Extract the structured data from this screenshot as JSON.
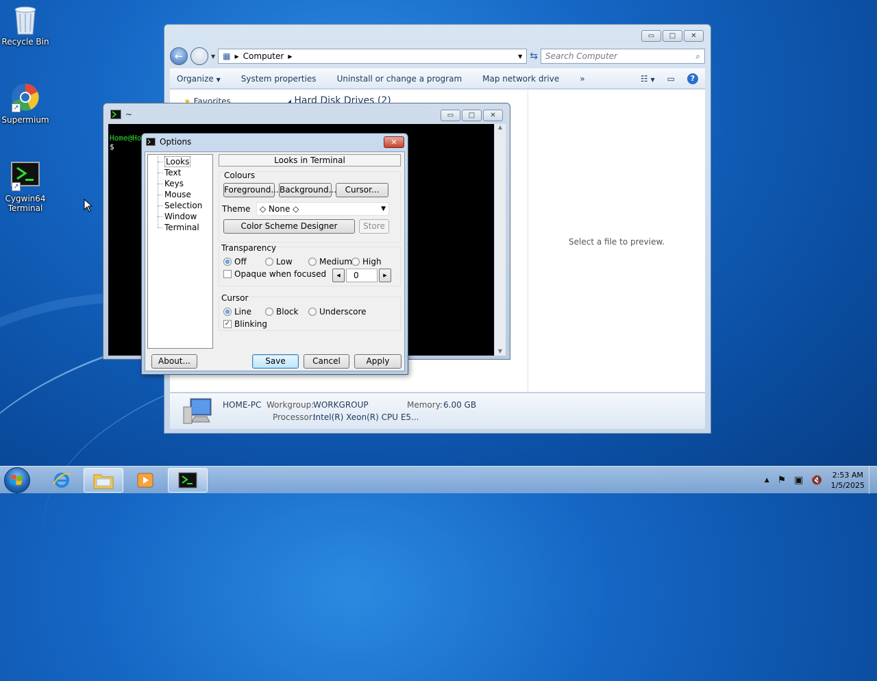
{
  "desktop": {
    "icons": [
      {
        "label": "Recycle Bin"
      },
      {
        "label": "Supermium"
      },
      {
        "label": "Cygwin64 Terminal"
      }
    ]
  },
  "explorer": {
    "address_parts": [
      "Computer"
    ],
    "search_placeholder": "Search Computer",
    "toolbar": {
      "organize": "Organize",
      "system_properties": "System properties",
      "uninstall": "Uninstall or change a program",
      "map_drive": "Map network drive",
      "more": "»"
    },
    "nav": {
      "favorites": "Favorites",
      "hard_disk_drives": "Hard Disk Drives (2)"
    },
    "preview_text": "Select a file to preview.",
    "details": {
      "pc_name": "HOME-PC",
      "workgroup_label": "Workgroup:",
      "workgroup_value": "WORKGROUP",
      "memory_label": "Memory:",
      "memory_value": "6.00 GB",
      "processor_label": "Processor:",
      "processor_value": "Intel(R) Xeon(R) CPU E5..."
    }
  },
  "terminal": {
    "title": "~",
    "prompt_line": "Home@Ho",
    "prompt_symbol": "$"
  },
  "options": {
    "title": "Options",
    "tree": [
      "Looks",
      "Text",
      "Keys",
      "Mouse",
      "Selection",
      "Window",
      "Terminal"
    ],
    "section_header": "Looks in Terminal",
    "colours": {
      "label": "Colours",
      "foreground": "Foreground...",
      "background": "Background...",
      "cursor": "Cursor..."
    },
    "theme": {
      "label": "Theme",
      "value": "◇ None ◇"
    },
    "color_scheme_designer": "Color Scheme Designer",
    "store": "Store",
    "transparency": {
      "label": "Transparency",
      "options": [
        "Off",
        "Low",
        "Medium",
        "High"
      ],
      "selected": "Off",
      "opaque_when_focused": "Opaque when focused",
      "value": "0"
    },
    "cursor": {
      "label": "Cursor",
      "options": [
        "Line",
        "Block",
        "Underscore"
      ],
      "selected": "Line",
      "blinking": "Blinking"
    },
    "buttons": {
      "about": "About...",
      "save": "Save",
      "cancel": "Cancel",
      "apply": "Apply"
    }
  },
  "taskbar": {
    "time": "2:53 AM",
    "date": "1/5/2025"
  }
}
